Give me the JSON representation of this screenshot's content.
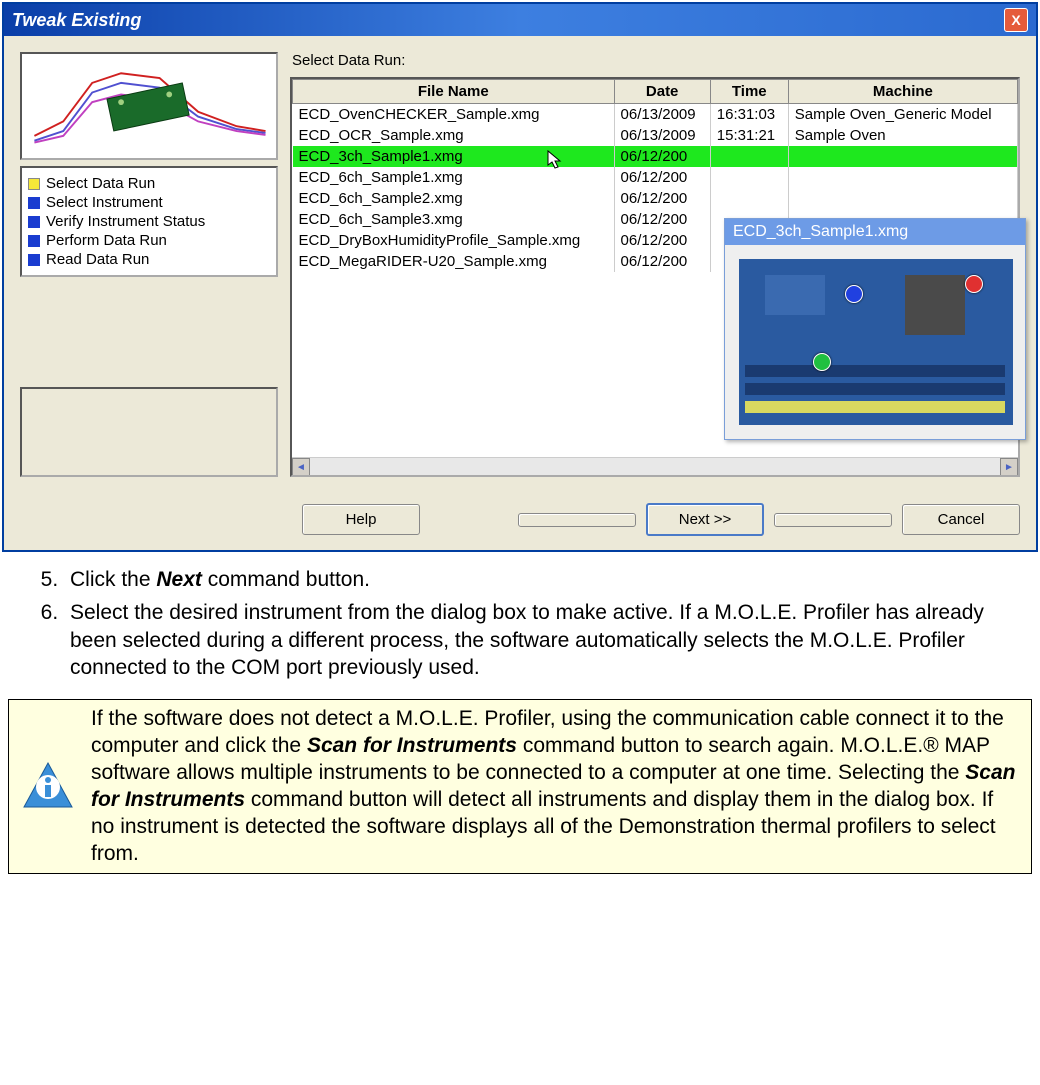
{
  "dialog": {
    "title": "Tweak Existing",
    "close_label": "X",
    "section_label": "Select Data Run:",
    "steps": [
      {
        "bullet": "yellow",
        "label": "Select Data Run"
      },
      {
        "bullet": "blue",
        "label": "Select Instrument"
      },
      {
        "bullet": "blue",
        "label": "Verify Instrument Status"
      },
      {
        "bullet": "blue",
        "label": "Perform Data Run"
      },
      {
        "bullet": "blue",
        "label": "Read Data Run"
      }
    ],
    "table": {
      "headers": {
        "file": "File Name",
        "date": "Date",
        "time": "Time",
        "machine": "Machine"
      },
      "rows": [
        {
          "file": "ECD_OvenCHECKER_Sample.xmg",
          "date": "06/13/2009",
          "time": "16:31:03",
          "machine": "Sample Oven_Generic Model",
          "selected": false
        },
        {
          "file": "ECD_OCR_Sample.xmg",
          "date": "06/13/2009",
          "time": "15:31:21",
          "machine": "Sample Oven",
          "selected": false
        },
        {
          "file": "ECD_3ch_Sample1.xmg",
          "date": "06/12/200",
          "time": "",
          "machine": "",
          "selected": true
        },
        {
          "file": "ECD_6ch_Sample1.xmg",
          "date": "06/12/200",
          "time": "",
          "machine": "",
          "selected": false
        },
        {
          "file": "ECD_6ch_Sample2.xmg",
          "date": "06/12/200",
          "time": "",
          "machine": "",
          "selected": false
        },
        {
          "file": "ECD_6ch_Sample3.xmg",
          "date": "06/12/200",
          "time": "",
          "machine": "",
          "selected": false
        },
        {
          "file": "ECD_DryBoxHumidityProfile_Sample.xmg",
          "date": "06/12/200",
          "time": "",
          "machine": "",
          "selected": false
        },
        {
          "file": "ECD_MegaRIDER-U20_Sample.xmg",
          "date": "06/12/200",
          "time": "",
          "machine": "",
          "selected": false
        }
      ]
    },
    "tooltip_title": "ECD_3ch_Sample1.xmg",
    "buttons": {
      "help": "Help",
      "back": "",
      "next": "Next >>",
      "finish": "",
      "cancel": "Cancel"
    }
  },
  "instructions": {
    "item5_pre": "Click the ",
    "item5_bold": "Next",
    "item5_post": " command button.",
    "item6": "Select the desired instrument from the dialog box to make active. If a M.O.L.E. Profiler has already been selected during a different process, the software automatically selects the M.O.L.E. Profiler connected to the COM port previously used."
  },
  "note": {
    "p1_pre": "If the software does not detect a M.O.L.E. Profiler, using the communication cable connect it to the computer and click the ",
    "p1_b1": "Scan for Instruments",
    "p1_mid": " command button to search again. M.O.L.E.® MAP software allows multiple instruments to be connected to a computer at one time. Selecting the ",
    "p1_b2": "Scan for Instruments",
    "p1_post": " command button will detect all instruments and display them in the dialog box. If no instrument is detected the software displays all of the Demonstration thermal profilers to select from."
  }
}
